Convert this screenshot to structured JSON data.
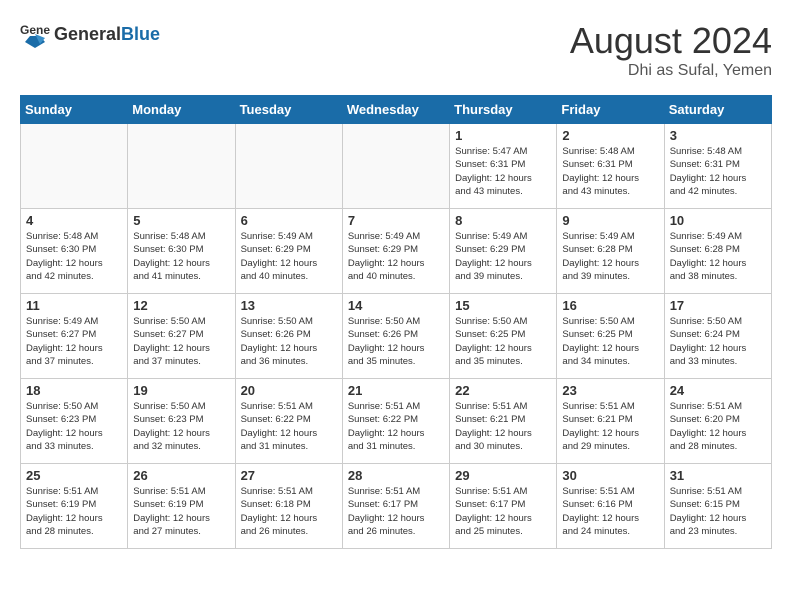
{
  "header": {
    "logo_general": "General",
    "logo_blue": "Blue",
    "month_year": "August 2024",
    "location": "Dhi as Sufal, Yemen"
  },
  "calendar": {
    "days_of_week": [
      "Sunday",
      "Monday",
      "Tuesday",
      "Wednesday",
      "Thursday",
      "Friday",
      "Saturday"
    ],
    "weeks": [
      [
        {
          "day": "",
          "info": ""
        },
        {
          "day": "",
          "info": ""
        },
        {
          "day": "",
          "info": ""
        },
        {
          "day": "",
          "info": ""
        },
        {
          "day": "1",
          "info": "Sunrise: 5:47 AM\nSunset: 6:31 PM\nDaylight: 12 hours\nand 43 minutes."
        },
        {
          "day": "2",
          "info": "Sunrise: 5:48 AM\nSunset: 6:31 PM\nDaylight: 12 hours\nand 43 minutes."
        },
        {
          "day": "3",
          "info": "Sunrise: 5:48 AM\nSunset: 6:31 PM\nDaylight: 12 hours\nand 42 minutes."
        }
      ],
      [
        {
          "day": "4",
          "info": "Sunrise: 5:48 AM\nSunset: 6:30 PM\nDaylight: 12 hours\nand 42 minutes."
        },
        {
          "day": "5",
          "info": "Sunrise: 5:48 AM\nSunset: 6:30 PM\nDaylight: 12 hours\nand 41 minutes."
        },
        {
          "day": "6",
          "info": "Sunrise: 5:49 AM\nSunset: 6:29 PM\nDaylight: 12 hours\nand 40 minutes."
        },
        {
          "day": "7",
          "info": "Sunrise: 5:49 AM\nSunset: 6:29 PM\nDaylight: 12 hours\nand 40 minutes."
        },
        {
          "day": "8",
          "info": "Sunrise: 5:49 AM\nSunset: 6:29 PM\nDaylight: 12 hours\nand 39 minutes."
        },
        {
          "day": "9",
          "info": "Sunrise: 5:49 AM\nSunset: 6:28 PM\nDaylight: 12 hours\nand 39 minutes."
        },
        {
          "day": "10",
          "info": "Sunrise: 5:49 AM\nSunset: 6:28 PM\nDaylight: 12 hours\nand 38 minutes."
        }
      ],
      [
        {
          "day": "11",
          "info": "Sunrise: 5:49 AM\nSunset: 6:27 PM\nDaylight: 12 hours\nand 37 minutes."
        },
        {
          "day": "12",
          "info": "Sunrise: 5:50 AM\nSunset: 6:27 PM\nDaylight: 12 hours\nand 37 minutes."
        },
        {
          "day": "13",
          "info": "Sunrise: 5:50 AM\nSunset: 6:26 PM\nDaylight: 12 hours\nand 36 minutes."
        },
        {
          "day": "14",
          "info": "Sunrise: 5:50 AM\nSunset: 6:26 PM\nDaylight: 12 hours\nand 35 minutes."
        },
        {
          "day": "15",
          "info": "Sunrise: 5:50 AM\nSunset: 6:25 PM\nDaylight: 12 hours\nand 35 minutes."
        },
        {
          "day": "16",
          "info": "Sunrise: 5:50 AM\nSunset: 6:25 PM\nDaylight: 12 hours\nand 34 minutes."
        },
        {
          "day": "17",
          "info": "Sunrise: 5:50 AM\nSunset: 6:24 PM\nDaylight: 12 hours\nand 33 minutes."
        }
      ],
      [
        {
          "day": "18",
          "info": "Sunrise: 5:50 AM\nSunset: 6:23 PM\nDaylight: 12 hours\nand 33 minutes."
        },
        {
          "day": "19",
          "info": "Sunrise: 5:50 AM\nSunset: 6:23 PM\nDaylight: 12 hours\nand 32 minutes."
        },
        {
          "day": "20",
          "info": "Sunrise: 5:51 AM\nSunset: 6:22 PM\nDaylight: 12 hours\nand 31 minutes."
        },
        {
          "day": "21",
          "info": "Sunrise: 5:51 AM\nSunset: 6:22 PM\nDaylight: 12 hours\nand 31 minutes."
        },
        {
          "day": "22",
          "info": "Sunrise: 5:51 AM\nSunset: 6:21 PM\nDaylight: 12 hours\nand 30 minutes."
        },
        {
          "day": "23",
          "info": "Sunrise: 5:51 AM\nSunset: 6:21 PM\nDaylight: 12 hours\nand 29 minutes."
        },
        {
          "day": "24",
          "info": "Sunrise: 5:51 AM\nSunset: 6:20 PM\nDaylight: 12 hours\nand 28 minutes."
        }
      ],
      [
        {
          "day": "25",
          "info": "Sunrise: 5:51 AM\nSunset: 6:19 PM\nDaylight: 12 hours\nand 28 minutes."
        },
        {
          "day": "26",
          "info": "Sunrise: 5:51 AM\nSunset: 6:19 PM\nDaylight: 12 hours\nand 27 minutes."
        },
        {
          "day": "27",
          "info": "Sunrise: 5:51 AM\nSunset: 6:18 PM\nDaylight: 12 hours\nand 26 minutes."
        },
        {
          "day": "28",
          "info": "Sunrise: 5:51 AM\nSunset: 6:17 PM\nDaylight: 12 hours\nand 26 minutes."
        },
        {
          "day": "29",
          "info": "Sunrise: 5:51 AM\nSunset: 6:17 PM\nDaylight: 12 hours\nand 25 minutes."
        },
        {
          "day": "30",
          "info": "Sunrise: 5:51 AM\nSunset: 6:16 PM\nDaylight: 12 hours\nand 24 minutes."
        },
        {
          "day": "31",
          "info": "Sunrise: 5:51 AM\nSunset: 6:15 PM\nDaylight: 12 hours\nand 23 minutes."
        }
      ]
    ]
  }
}
